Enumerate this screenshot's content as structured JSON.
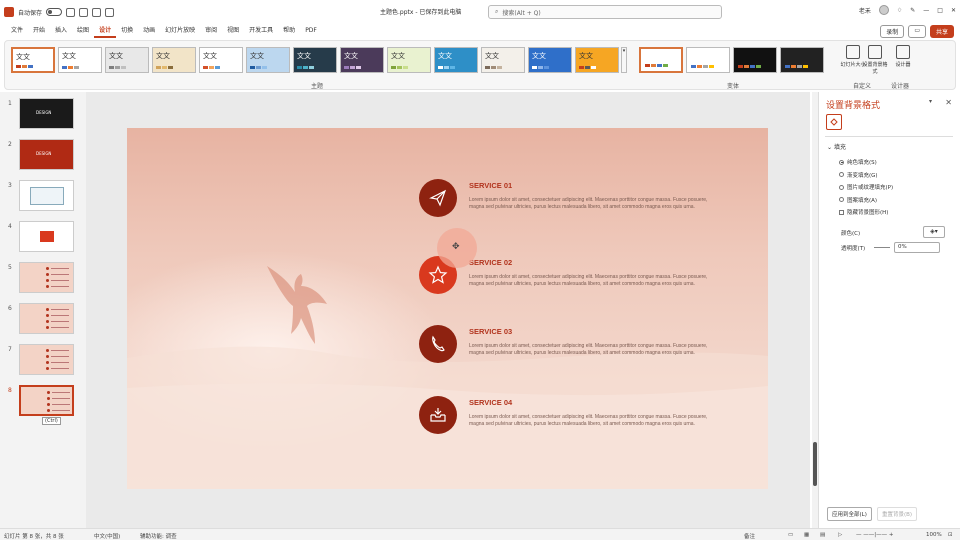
{
  "titlebar": {
    "autosave_label": "自动保存",
    "doc_title": "主题色.pptx - 已保存到此电脑",
    "search_placeholder": "搜索(Alt + Q)",
    "user": "老禾",
    "share_label": "共享"
  },
  "tabs": [
    "文件",
    "开始",
    "插入",
    "绘图",
    "设计",
    "切换",
    "动画",
    "幻灯片放映",
    "审阅",
    "视图",
    "开发工具",
    "帮助",
    "PDF"
  ],
  "active_tab": "设计",
  "tab_buttons": {
    "record": "录制",
    "share": "共享"
  },
  "ribbon": {
    "themes_label": "主题",
    "variants_label": "变体",
    "customize_label": "自定义",
    "designer_label": "设计器",
    "tools": [
      "幻灯片大小",
      "设置背景格式",
      "设计器"
    ],
    "theme_text": "文文",
    "themes": [
      {
        "bg": "#ffffff",
        "c": [
          "#c43e1c",
          "#e07b39",
          "#4472c4"
        ]
      },
      {
        "bg": "#ffffff",
        "c": [
          "#4472c4",
          "#ed7d31",
          "#a5a5a5"
        ]
      },
      {
        "bg": "#e8e8e8",
        "c": [
          "#7f7f7f",
          "#a0a0a0",
          "#c0c0c0"
        ]
      },
      {
        "bg": "#f2e4c8",
        "c": [
          "#d1a35b",
          "#e3b96d",
          "#8a6d3b"
        ]
      },
      {
        "bg": "#ffffff",
        "c": [
          "#d4512a",
          "#f1a45c",
          "#5b9bd5"
        ]
      },
      {
        "bg": "#bcd7ef",
        "c": [
          "#1e5aa0",
          "#6c9bd1",
          "#93c0ea"
        ]
      },
      {
        "bg": "#263b4a",
        "c": [
          "#2d8da8",
          "#4fb3c9",
          "#91d0de"
        ]
      },
      {
        "bg": "#4b3a5a",
        "c": [
          "#9b7bb9",
          "#c3a4d6",
          "#e0c9ea"
        ]
      },
      {
        "bg": "#e9f2d0",
        "c": [
          "#7fa33b",
          "#a4c35c",
          "#c9de8c"
        ]
      },
      {
        "bg": "#2e8fc7",
        "c": [
          "#ffffff",
          "#9ed4f2",
          "#5fb6e6"
        ]
      },
      {
        "bg": "#f3f0ea",
        "c": [
          "#7b6a5a",
          "#a08c78",
          "#c4b39f"
        ]
      },
      {
        "bg": "#2f6fc9",
        "c": [
          "#ffffff",
          "#8fb5ea",
          "#5d93dd"
        ]
      },
      {
        "bg": "#f6a623",
        "c": [
          "#c43e1c",
          "#5b5b5b",
          "#ffffff"
        ]
      }
    ],
    "variants": [
      {
        "bg": "#ffffff",
        "c": [
          "#c43e1c",
          "#e07b39",
          "#4472c4",
          "#70ad47"
        ]
      },
      {
        "bg": "#ffffff",
        "c": [
          "#4472c4",
          "#ed7d31",
          "#a5a5a5",
          "#ffc000"
        ]
      },
      {
        "bg": "#111111",
        "c": [
          "#c43e1c",
          "#e07b39",
          "#4472c4",
          "#70ad47"
        ]
      },
      {
        "bg": "#222222",
        "c": [
          "#4472c4",
          "#ed7d31",
          "#a5a5a5",
          "#ffc000"
        ]
      }
    ]
  },
  "slides_panel": {
    "slides": [
      {
        "num": "1",
        "bg": "#1a1a1a",
        "label": "DESIGN"
      },
      {
        "num": "2",
        "bg": "#b02a14",
        "label": "DESIGN"
      },
      {
        "num": "3",
        "bg": "#ffffff",
        "label": ""
      },
      {
        "num": "4",
        "bg": "#ffffff",
        "label": ""
      },
      {
        "num": "5",
        "bg": "#f3d3c6",
        "label": ""
      },
      {
        "num": "6",
        "bg": "#f3d3c6",
        "label": ""
      },
      {
        "num": "7",
        "bg": "#f3d3c6",
        "label": ""
      },
      {
        "num": "8",
        "bg": "#f3d3c6",
        "label": ""
      }
    ],
    "selected": "8",
    "paste_label": "(Ctrl)"
  },
  "slide": {
    "services": [
      {
        "title": "SERVICE 01",
        "icon": "paper-plane-icon",
        "body": "Lorem ipsum dolor sit amet, consectetuer adipiscing elit. Maecenas porttitor congue massa. Fusce posuere, magna sed pulvinar ultricies, purus lectus malesuada libero, sit amet commodo magna eros quis urna."
      },
      {
        "title": "SERVICE 02",
        "icon": "star-icon",
        "body": "Lorem ipsum dolor sit amet, consectetuer adipiscing elit. Maecenas porttitor congue massa. Fusce posuere, magna sed pulvinar ultricies, purus lectus malesuada libero, sit amet commodo magna eros quis urna."
      },
      {
        "title": "SERVICE 03",
        "icon": "phone-icon",
        "body": "Lorem ipsum dolor sit amet, consectetuer adipiscing elit. Maecenas porttitor congue massa. Fusce posuere, magna sed pulvinar ultricies, purus lectus malesuada libero, sit amet commodo magna eros quis urna."
      },
      {
        "title": "SERVICE 04",
        "icon": "inbox-icon",
        "body": "Lorem ipsum dolor sit amet, consectetuer adipiscing elit. Maecenas porttitor congue massa. Fusce posuere, magna sed pulvinar ultricies, purus lectus malesuada libero, sit amet commodo magna eros quis urna."
      }
    ],
    "accent_dark": "#8e2210",
    "accent_bright": "#d9391e"
  },
  "format_pane": {
    "title": "设置背景格式",
    "section": "填充",
    "options": [
      "纯色填充(S)",
      "渐变填充(G)",
      "图片或纹理填充(P)",
      "图案填充(A)"
    ],
    "selected_option": "纯色填充(S)",
    "hide_bg": "隐藏背景图形(H)",
    "color_label": "颜色(C)",
    "transparency_label": "透明度(T)",
    "transparency_value": "0%",
    "apply_all": "应用到全部(L)",
    "reset_bg": "重置背景(B)"
  },
  "statusbar": {
    "slide_info": "幻灯片 第 8 张，共 8 张",
    "language": "中文(中国)",
    "accessibility": "辅助功能: 调查",
    "notes": "备注",
    "zoom": "100%"
  }
}
